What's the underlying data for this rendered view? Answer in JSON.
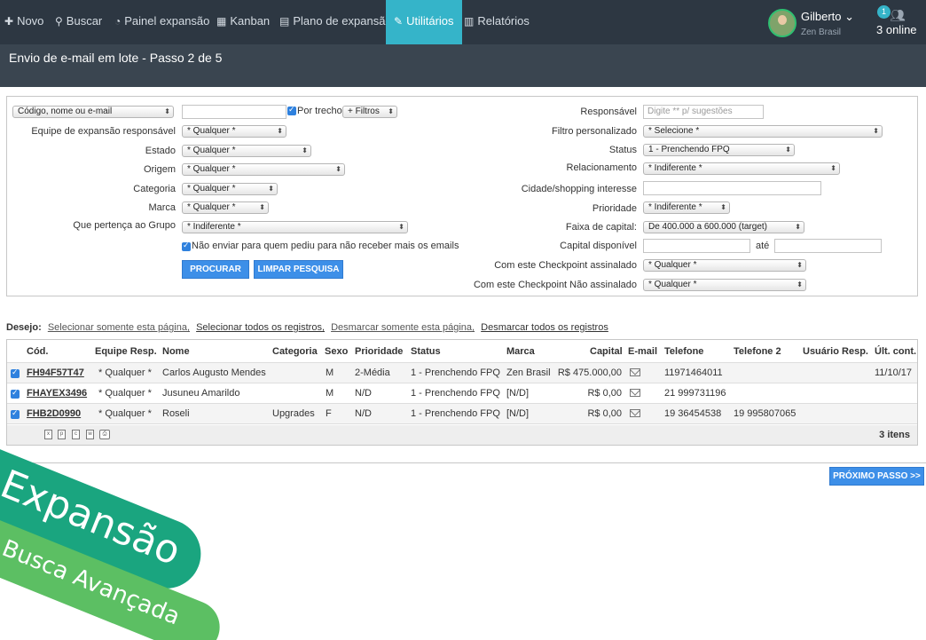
{
  "nav": {
    "novo": "Novo",
    "buscar": "Buscar",
    "painel": "Painel expansão",
    "kanban": "Kanban",
    "plano": "Plano de expansão",
    "utilitarios": "Utilitários",
    "relatorios": "Relatórios"
  },
  "user": {
    "name": "Gilberto",
    "company": "Zen Brasil",
    "online_badge": "1",
    "online_text": "3 online"
  },
  "page_title": "Envio de e-mail em lote - Passo 2 de 5",
  "filters_left": {
    "search_type": "Código, nome ou e-mail",
    "search_value": "",
    "por_trecho": "Por trecho",
    "filtros": "+ Filtros",
    "equipe_label": "Equipe de expansão responsável",
    "equipe_value": "* Qualquer *",
    "estado_label": "Estado",
    "estado_value": "* Qualquer *",
    "origem_label": "Origem",
    "origem_value": "* Qualquer *",
    "categoria_label": "Categoria",
    "categoria_value": "* Qualquer *",
    "marca_label": "Marca",
    "marca_value": "* Qualquer *",
    "grupo_label": "Que pertença ao Grupo",
    "grupo_value": "* Indiferente *",
    "nao_enviar": "Não enviar para quem pediu para não receber mais os emails",
    "procurar": "PROCURAR",
    "limpar": "LIMPAR PESQUISA"
  },
  "filters_right": {
    "responsavel_label": "Responsável",
    "responsavel_placeholder": "Digite ** p/ sugestões",
    "filtro_label": "Filtro personalizado",
    "filtro_value": "* Selecione *",
    "status_label": "Status",
    "status_value": "1 - Prenchendo FPQ",
    "relacionamento_label": "Relacionamento",
    "relacionamento_value": "* Indiferente *",
    "cidade_label": "Cidade/shopping interesse",
    "prioridade_label": "Prioridade",
    "prioridade_value": "* Indiferente *",
    "faixa_label": "Faixa de capital:",
    "faixa_value": "De 400.000 a 600.000 (target)",
    "capital_label": "Capital disponível",
    "ate": "até",
    "checkpoint_label": "Com este Checkpoint assinalado",
    "checkpoint_value": "* Qualquer *",
    "checkpoint_nao_label": "Com este Checkpoint Não assinalado",
    "checkpoint_nao_value": "* Qualquer *"
  },
  "desejo": {
    "label": "Desejo:",
    "sel_pagina": "Selecionar somente esta página,",
    "sel_todos": "Selecionar todos os registros,",
    "desm_pagina": "Desmarcar somente esta página,",
    "desm_todos": "Desmarcar todos os registros"
  },
  "table": {
    "headers": [
      "Cód.",
      "Equipe Resp.",
      "Nome",
      "Categoria",
      "Sexo",
      "Prioridade",
      "Status",
      "Marca",
      "Capital",
      "E-mail",
      "Telefone",
      "Telefone 2",
      "Usuário Resp.",
      "Últ. cont."
    ],
    "rows": [
      {
        "cod": "FH94F57T47",
        "equipe": "* Qualquer *",
        "nome": "Carlos Augusto Mendes",
        "categoria": "",
        "sexo": "M",
        "prioridade": "2-Média",
        "status": "1 - Prenchendo FPQ",
        "marca": "Zen Brasil",
        "capital": "R$ 475.000,00",
        "telefone": "11971464011",
        "telefone2": "",
        "usuario": "",
        "ult": "11/10/17"
      },
      {
        "cod": "FHAYEX3496",
        "equipe": "* Qualquer *",
        "nome": "Jusuneu Amarildo",
        "categoria": "",
        "sexo": "M",
        "prioridade": "N/D",
        "status": "1 - Prenchendo FPQ",
        "marca": "[N/D]",
        "capital": "R$ 0,00",
        "telefone": "21 999731196",
        "telefone2": "",
        "usuario": "",
        "ult": ""
      },
      {
        "cod": "FHB2D0990",
        "equipe": "* Qualquer *",
        "nome": "Roseli",
        "categoria": "Upgrades",
        "sexo": "F",
        "prioridade": "N/D",
        "status": "1 - Prenchendo FPQ",
        "marca": "[N/D]",
        "capital": "R$ 0,00",
        "telefone": "19 36454538",
        "telefone2": "19 995807065",
        "usuario": "",
        "ult": ""
      }
    ],
    "count": "3  itens",
    "export_icons": [
      "excel-icon",
      "pdf-icon",
      "csv-icon",
      "word-icon",
      "print-icon"
    ]
  },
  "next_button": "PRÓXIMO PASSO >>",
  "ribbon": {
    "title": "Expansão",
    "subtitle": "Busca Avançada"
  }
}
